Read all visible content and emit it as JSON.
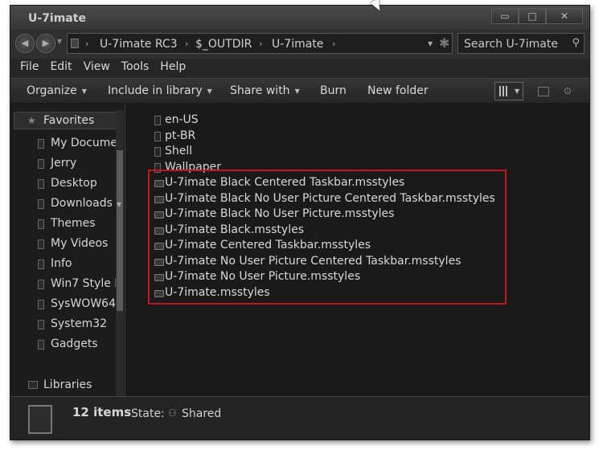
{
  "window": {
    "title": "U-7imate",
    "buttons": {
      "minimize": "▭",
      "maximize": "□",
      "close": "✕"
    }
  },
  "address": {
    "segments": [
      "U-7imate RC3",
      "$_OUTDIR",
      "U-7imate"
    ],
    "separator": "›"
  },
  "search": {
    "placeholder": "Search U-7imate"
  },
  "menu": [
    "File",
    "Edit",
    "View",
    "Tools",
    "Help"
  ],
  "toolbar": {
    "organize": "Organize",
    "include": "Include in library",
    "share": "Share with",
    "burn": "Burn",
    "new_folder": "New folder"
  },
  "sidebar": {
    "favorites": "Favorites",
    "items": [
      "My Docume",
      "Jerry",
      "Desktop",
      "Downloads",
      "Themes",
      "My Videos",
      "Info",
      "Win7 Style I",
      "SysWOW64",
      "System32",
      "Gadgets"
    ],
    "libraries": "Libraries"
  },
  "files": {
    "folders": [
      "en-US",
      "pt-BR",
      "Shell",
      "Wallpaper"
    ],
    "styles": [
      "U-7imate Black Centered Taskbar.msstyles",
      "U-7imate Black No User Picture Centered Taskbar.msstyles",
      "U-7imate Black No User Picture.msstyles",
      "U-7imate Black.msstyles",
      "U-7imate Centered Taskbar.msstyles",
      "U-7imate No User Picture Centered Taskbar.msstyles",
      "U-7imate No User Picture.msstyles",
      "U-7imate.msstyles"
    ]
  },
  "status": {
    "count": "12 items",
    "state_label": "State:",
    "state_value": "Shared"
  },
  "colors": {
    "window_bg": "#3a3a3a",
    "content_bg": "#1a1a1a",
    "highlight_box": "#c0161e",
    "text": "#d8d8d8"
  },
  "icons": {
    "folder": "folder-icon",
    "msstyles": "msstyles-file-icon",
    "star": "star-icon",
    "search": "search-icon"
  }
}
